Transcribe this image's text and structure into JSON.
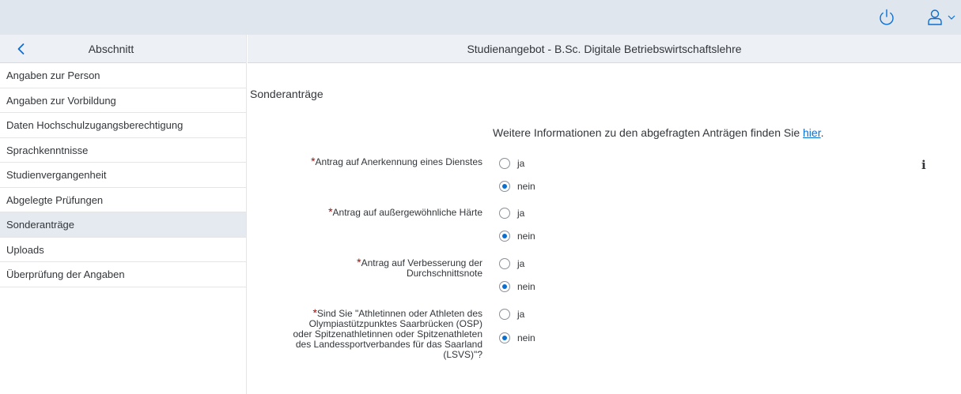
{
  "shell": {
    "power_icon": "power-icon",
    "user_icon": "user-icon"
  },
  "sidebar": {
    "title": "Abschnitt",
    "items": [
      {
        "label": "Angaben zur Person"
      },
      {
        "label": "Angaben zur Vorbildung"
      },
      {
        "label": "Daten Hochschulzugangsberechtigung"
      },
      {
        "label": "Sprachkenntnisse"
      },
      {
        "label": "Studienvergangenheit"
      },
      {
        "label": "Abgelegte Prüfungen"
      },
      {
        "label": "Sonderanträge",
        "active": true
      },
      {
        "label": "Uploads"
      },
      {
        "label": "Überprüfung der Angaben"
      }
    ]
  },
  "main": {
    "header_title": "Studienangebot - B.Sc. Digitale Betriebswirtschaftslehre",
    "section_title": "Sonderanträge",
    "info_text": "Weitere Informationen zu den abgefragten Anträgen finden Sie ",
    "info_link": "hier",
    "info_suffix": ".",
    "info_icon": "i",
    "required_mark": "*",
    "option_yes": "ja",
    "option_no": "nein",
    "questions": [
      {
        "label": "Antrag auf Anerkennung eines Dienstes",
        "selected": "nein"
      },
      {
        "label": "Antrag auf außergewöhnliche Härte",
        "selected": "nein"
      },
      {
        "label_line1": "Antrag auf Verbesserung der",
        "label_line2": "Durchschnittsnote",
        "selected": "nein"
      },
      {
        "label_line1": "Sind Sie \"Athletinnen oder Athleten des",
        "label_line2": "Olympiastützpunktes Saarbrücken (OSP)",
        "label_line3": "oder Spitzenathletinnen oder Spitzenathleten",
        "label_line4": "des Landessportverbandes für das Saarland",
        "label_line5": "(LSVS)\"?",
        "selected": "nein"
      }
    ]
  }
}
